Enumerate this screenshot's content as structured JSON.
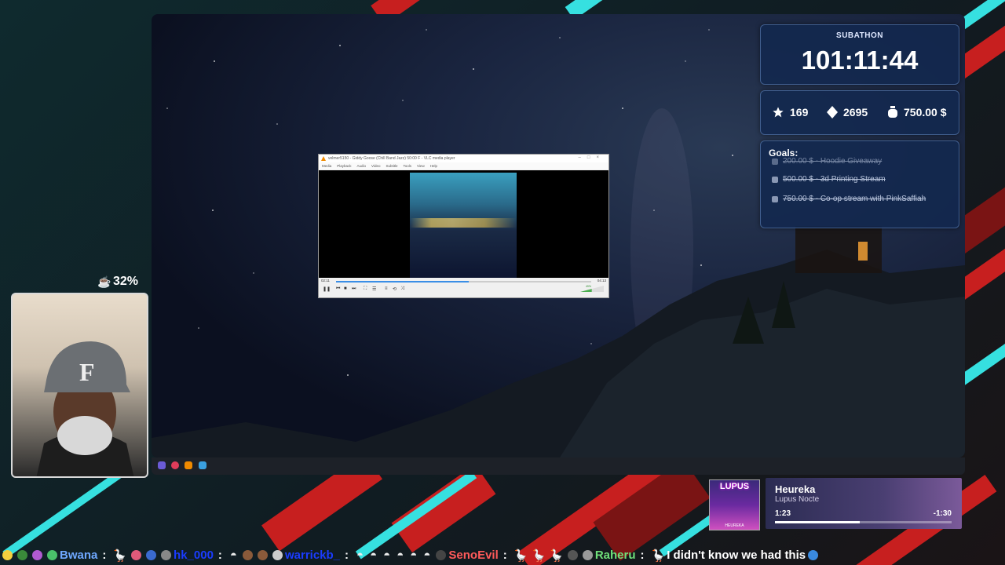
{
  "subathon": {
    "title": "SUBATHON",
    "timer": "101:11:44"
  },
  "stats": {
    "stars": "169",
    "diamonds": "2695",
    "money": "750.00 $"
  },
  "goals": {
    "title": "Goals:",
    "items": [
      "200.00 $ - Hoodie Giveaway",
      "500.00 $ - 3d Printing Stream",
      "750.00 $ - Co-op stream with PinkSaffiah"
    ]
  },
  "webcam": {
    "drink_percent": "32%"
  },
  "vlc": {
    "title": "velmer5150 - Giddy Goose (Chill Band Jazz) 50:00 F - VLC media player",
    "menu": [
      "Media",
      "Playback",
      "Audio",
      "Video",
      "Subtitle",
      "Tools",
      "View",
      "Help"
    ],
    "time_current": "02:11",
    "time_total": "04:13",
    "progress": 0.52,
    "volume": "49%"
  },
  "music": {
    "album_title": "LUPUS",
    "album_subtitle": "HEUREKA",
    "title": "Heureka",
    "artist": "Lupus Nocte",
    "current": "1:23",
    "remaining": "-1:30",
    "progress": 0.48
  },
  "chat": [
    {
      "user": "Bwana",
      "color": "#6fa8ff",
      "message": ""
    },
    {
      "user": "hk_000",
      "color": "#1a3cff",
      "message": ""
    },
    {
      "user": "warrickb_",
      "color": "#1a3cff",
      "message": ""
    },
    {
      "user": "SenoEvil",
      "color": "#ff5a5a",
      "message": ""
    },
    {
      "user": "Raheru",
      "color": "#6fe07a",
      "message": "I didn't know we had this"
    }
  ],
  "colors": {
    "panel_bg": "#12284e",
    "stripe_red": "#c71f1f",
    "stripe_cyan": "#36e0e0"
  }
}
